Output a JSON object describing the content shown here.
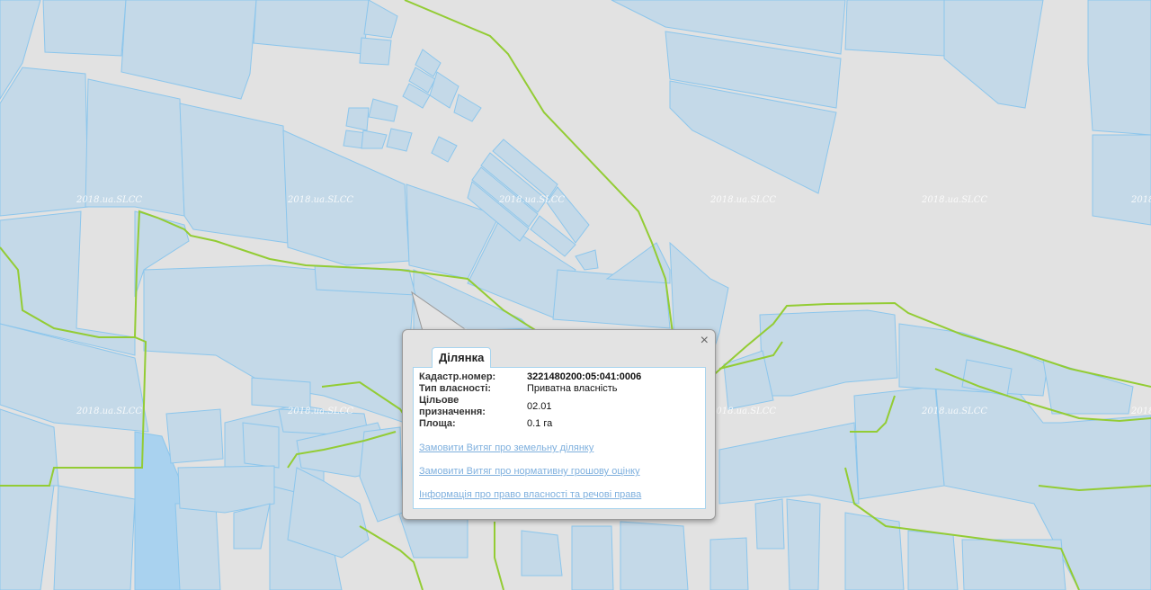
{
  "map": {
    "watermark": "2018.ua.SLCC",
    "colors": {
      "background": "#e2e2e2",
      "parcel_fill": "#c4d9e8",
      "parcel_stroke": "#8cc6ec",
      "boundary": "#93cc34"
    }
  },
  "popup": {
    "close_icon": "×",
    "tab_label": "Ділянка",
    "fields": [
      {
        "label": "Кадастр.номер:",
        "value": "3221480200:05:041:0006"
      },
      {
        "label": "Тип власності:",
        "value": "Приватна власність"
      },
      {
        "label": "Цільове призначення:",
        "value": "02.01"
      },
      {
        "label": "Площа:",
        "value": "0.1 га"
      }
    ],
    "links": [
      "Замовити Витяг про земельну ділянку",
      "Замовити Витяг про нормативну грошову оцінку",
      "Інформація про право власності та речові права"
    ]
  }
}
